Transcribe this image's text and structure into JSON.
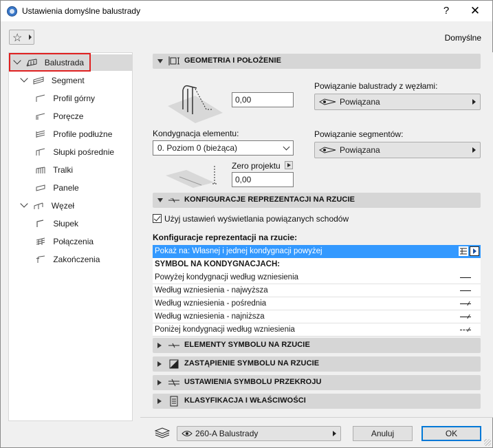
{
  "window": {
    "title": "Ustawienia domyślne balustrady",
    "help": "?",
    "close": "✕"
  },
  "header": {
    "favorites_icon": "star-icon",
    "default_label": "Domyślne"
  },
  "tree": {
    "items": [
      {
        "label": "Balustrada",
        "level": 0,
        "expanded": true,
        "selected": true
      },
      {
        "label": "Segment",
        "level": 1,
        "expanded": true
      },
      {
        "label": "Profil górny",
        "level": 2
      },
      {
        "label": "Poręcze",
        "level": 2
      },
      {
        "label": "Profile podłużne",
        "level": 2
      },
      {
        "label": "Słupki pośrednie",
        "level": 2
      },
      {
        "label": "Tralki",
        "level": 2
      },
      {
        "label": "Panele",
        "level": 2
      },
      {
        "label": "Węzeł",
        "level": 1,
        "expanded": true
      },
      {
        "label": "Słupek",
        "level": 2
      },
      {
        "label": "Połączenia",
        "level": 2
      },
      {
        "label": "Zakończenia",
        "level": 2
      }
    ]
  },
  "geometry": {
    "title": "GEOMETRIA I POŁOŻENIE",
    "offset_value": "0,00",
    "story_label": "Kondygnacja elementu:",
    "story_value": "0. Poziom 0 (bieżąca)",
    "zero_label": "Zero projektu",
    "zero_value": "0,00",
    "node_link_label": "Powiązanie balustrady z węzłami:",
    "node_link_value": "Powiązana",
    "segment_link_label": "Powiązanie segmentów:",
    "segment_link_value": "Powiązana"
  },
  "plan": {
    "title": "KONFIGURACJE REPREZENTACJI NA RZUCIE",
    "checkbox_label": "Użyj ustawień wyświetlania powiązanych schodów",
    "checked": true,
    "config_label": "Konfiguracje reprezentacji na rzucie:",
    "show_on": "Pokaż na: Własnej i jednej kondygnacji powyżej",
    "symbol_header": "SYMBOL NA KONDYGNACJACH:",
    "rows": [
      "Powyżej kondygnacji według wzniesienia",
      "Według wzniesienia - najwyższa",
      "Według wzniesienia - pośrednia",
      "Według wzniesienia - najniższa",
      "Poniżej kondygnacji według wzniesienia"
    ]
  },
  "sections": [
    {
      "title": "ELEMENTY SYMBOLU NA RZUCIE"
    },
    {
      "title": "ZASTĄPIENIE SYMBOLU NA RZUCIE"
    },
    {
      "title": "USTAWIENIA SYMBOLU PRZEKROJU"
    },
    {
      "title": "KLASYFIKACJA I WŁAŚCIWOŚCI"
    }
  ],
  "footer": {
    "layer_value": "260-A Balustrady",
    "cancel_label": "Anuluj",
    "ok_label": "OK"
  },
  "colors": {
    "accent": "#3399ff",
    "selection_outline": "#e02020"
  }
}
